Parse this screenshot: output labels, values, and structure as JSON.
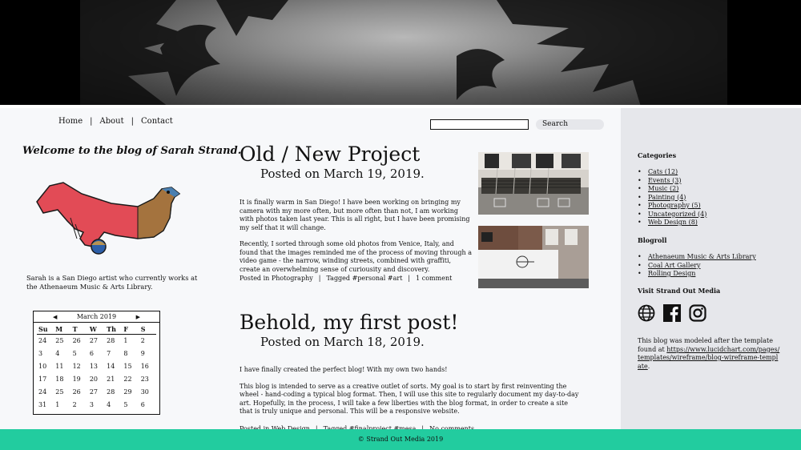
{
  "nav": {
    "items": [
      {
        "label": "Home"
      },
      {
        "label": "About"
      },
      {
        "label": "Contact"
      }
    ],
    "separator": "|"
  },
  "search": {
    "button_label": "Search",
    "value": ""
  },
  "sidebar_left": {
    "welcome": "Welcome to the blog of Sarah Strand.",
    "bio": "Sarah is a San Diego artist who currently works at the Athenaeum Music & Arts Library."
  },
  "calendar": {
    "month": "March 2019",
    "prev_icon": "◀",
    "next_icon": "▶",
    "days_of_week": [
      "Su",
      "M",
      "T",
      "W",
      "Th",
      "F",
      "S"
    ],
    "weeks": [
      [
        "24",
        "25",
        "26",
        "27",
        "28",
        "1",
        "2"
      ],
      [
        "3",
        "4",
        "5",
        "6",
        "7",
        "8",
        "9"
      ],
      [
        "10",
        "11",
        "12",
        "13",
        "14",
        "15",
        "16"
      ],
      [
        "17",
        "18",
        "19",
        "20",
        "21",
        "22",
        "23"
      ],
      [
        "24",
        "25",
        "26",
        "27",
        "28",
        "29",
        "30"
      ],
      [
        "31",
        "1",
        "2",
        "3",
        "4",
        "5",
        "6"
      ]
    ]
  },
  "posts": [
    {
      "title": "Old / New Project",
      "date": "Posted on March 19, 2019.",
      "paragraphs": [
        "It is finally warm in San Diego! I have been working on bringing my camera with my more often, but more often than not, I am working with photos taken last year. This is all right, but I have been promising my self that it will change.",
        "Recently, I sorted through some old photos from Venice, Italy, and found that the images reminded me of the process of moving through a video game - the narrow, winding streets, combined with graffiti, create an overwhelming sense of curiousity and discovery."
      ],
      "meta": {
        "category": "Posted in Photography",
        "tags": "Tagged #personal #art",
        "comments": "1 comment"
      }
    },
    {
      "title": "Behold, my first post!",
      "date": "Posted on March 18, 2019.",
      "paragraphs": [
        "I have finally created the perfect blog! With my own two hands!",
        "This blog is intended to serve as a creative outlet of sorts. My goal is to start by first reinventing the wheel - hand-coding a typical blog format. Then, I will use this site to regularly document my day-to-day art. Hopefully, in the process, I will take a few liberties with the blog format, in order to create a site that is truly unique and personal. This will be a responsive website."
      ],
      "meta": {
        "category": "Posted in Web Design",
        "tags": "Tagged #finalproject #mesa",
        "comments": "No comments"
      }
    }
  ],
  "sidebar_right": {
    "categories_heading": "Categories",
    "categories": [
      "Cats (12)",
      "Events (3)",
      "Music (2)",
      "Painting (4)",
      "Photography (5)",
      "Uncategorized (4)",
      "Web Design (8)"
    ],
    "blogroll_heading": "Blogroll",
    "blogroll": [
      "Athenaeum Music & Arts Library",
      "Coal Art Gallery",
      "Rolling Design"
    ],
    "social_heading": "Visit Strand Out Media",
    "social_icons": [
      "globe-icon",
      "facebook-icon",
      "instagram-icon"
    ],
    "note_text": "This blog was modeled after the template found at ",
    "note_link": "https://www.lucidchart.com/pages/templates/wireframe/blog-wireframe-template",
    "note_end": "."
  },
  "footer": {
    "text": "© Strand Out Media 2019"
  },
  "colors": {
    "footer": "#22cc9f",
    "sidebar": "#e6e7eb",
    "background": "#f7f8fa"
  }
}
